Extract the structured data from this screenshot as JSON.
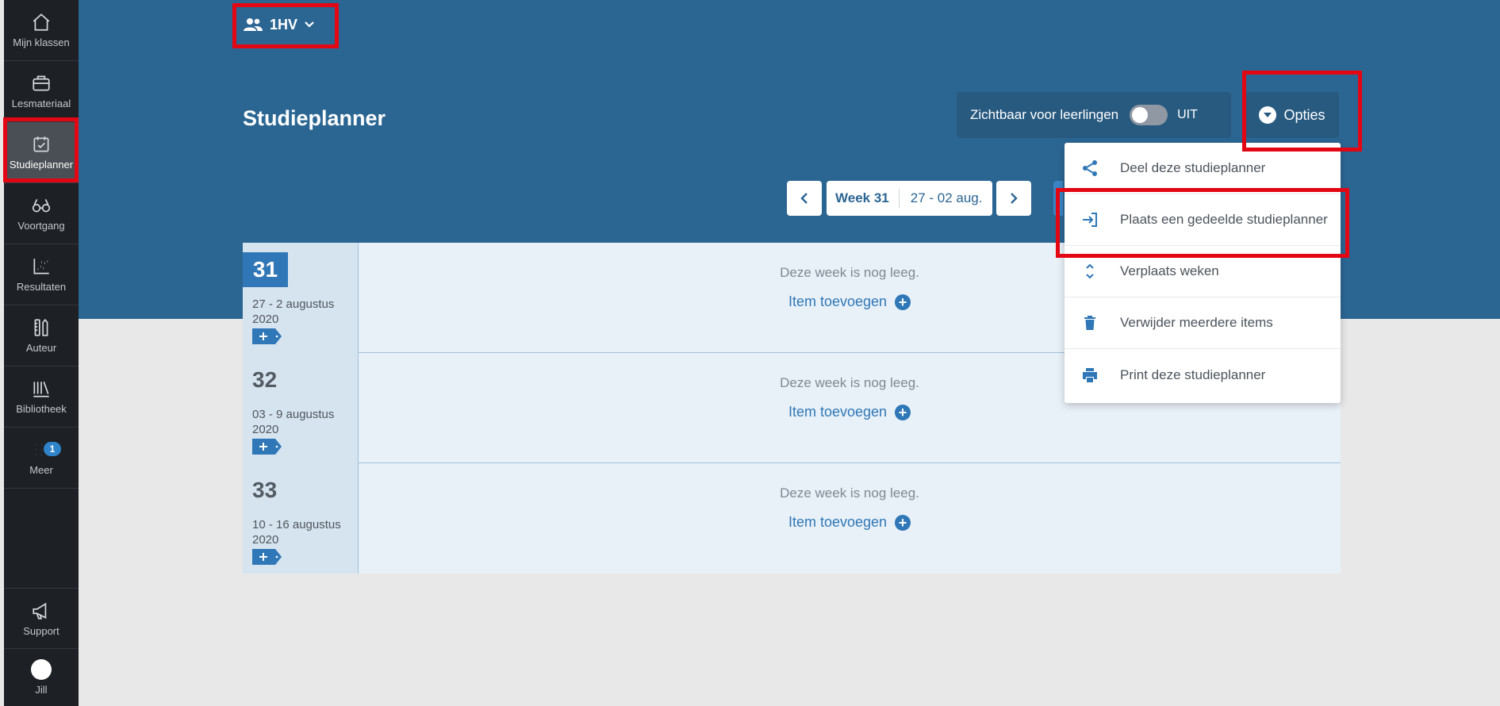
{
  "sidebar": {
    "items": [
      {
        "label": "Mijn klassen",
        "icon": "home-icon"
      },
      {
        "label": "Lesmateriaal",
        "icon": "briefcase-icon"
      },
      {
        "label": "Studieplanner",
        "icon": "calendar-check-icon",
        "active": true
      },
      {
        "label": "Voortgang",
        "icon": "glasses-icon"
      },
      {
        "label": "Resultaten",
        "icon": "scatter-chart-icon"
      },
      {
        "label": "Auteur",
        "icon": "ruler-pencil-icon"
      },
      {
        "label": "Bibliotheek",
        "icon": "books-icon"
      },
      {
        "label": "Meer",
        "icon": "grid-icon",
        "badge": "1"
      }
    ],
    "support_label": "Support",
    "user_label": "Jill"
  },
  "header": {
    "class_name": "1HV",
    "page_title": "Studieplanner",
    "visibility_label": "Zichtbaar voor leerlingen",
    "visibility_state": "UIT",
    "options_label": "Opties"
  },
  "week_nav": {
    "week_label": "Week 31",
    "range_label": "27 - 02 aug."
  },
  "weeks": [
    {
      "number": "31",
      "dates": "27 - 2 augustus 2020",
      "empty_text": "Deze week is nog leeg.",
      "add_label": "Item toevoegen",
      "current": true
    },
    {
      "number": "32",
      "dates": "03 - 9 augustus 2020",
      "empty_text": "Deze week is nog leeg.",
      "add_label": "Item toevoegen"
    },
    {
      "number": "33",
      "dates": "10 - 16 augustus 2020",
      "empty_text": "Deze week is nog leeg.",
      "add_label": "Item toevoegen"
    }
  ],
  "options_menu": [
    {
      "label": "Deel deze studieplanner",
      "icon": "share-icon"
    },
    {
      "label": "Plaats een gedeelde studieplanner",
      "icon": "import-icon"
    },
    {
      "label": "Verplaats weken",
      "icon": "chevron-up-down-icon"
    },
    {
      "label": "Verwijder meerdere items",
      "icon": "trash-icon"
    },
    {
      "label": "Print deze studieplanner",
      "icon": "printer-icon"
    }
  ],
  "colors": {
    "header_blue": "#2b6693",
    "accent_blue": "#2f77b7",
    "sidebar_bg": "#1d2024",
    "highlight_red": "#e30613"
  }
}
